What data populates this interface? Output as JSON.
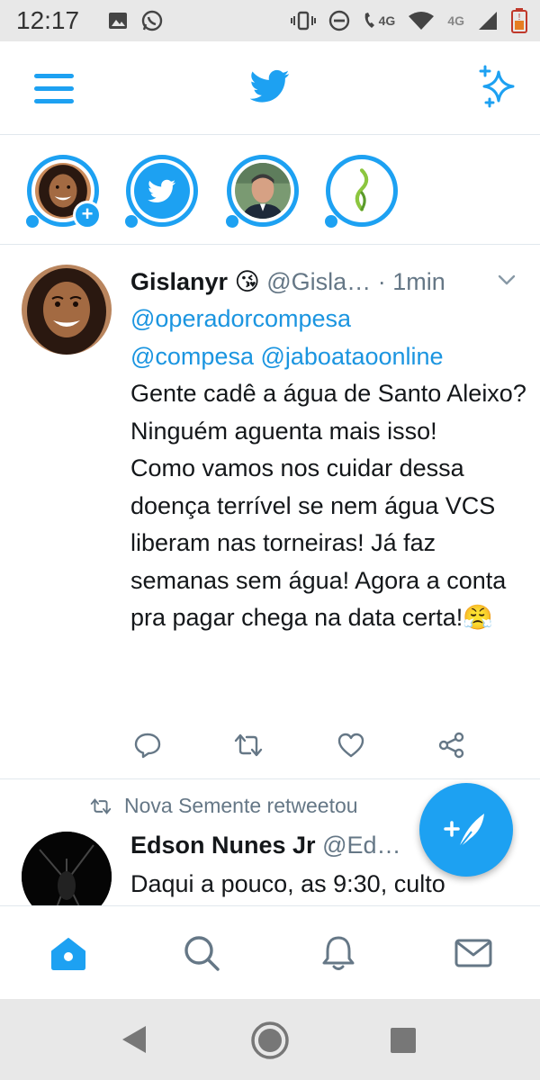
{
  "status_bar": {
    "time": "12:17",
    "network_label_1": "4G",
    "network_label_2": "4G"
  },
  "app_bar": {
    "menu_icon": "hamburger-menu-icon",
    "logo_icon": "twitter-bird-icon",
    "sparkle_icon": "sparkle-icon"
  },
  "fleets": [
    {
      "name": "own-fleet",
      "has_add": true
    },
    {
      "name": "twitter-fleet"
    },
    {
      "name": "user-fleet"
    },
    {
      "name": "plant-fleet"
    }
  ],
  "tweet1": {
    "name": "Gislanyr",
    "emoji": "😘",
    "handle": "@Gisla…",
    "dot": " · ",
    "time": "1min",
    "mentions_line1": "@operadorcompesa",
    "mention_2": "@compesa",
    "mention_3": "@jaboataoonline",
    "text": "Gente cadê a água de Santo Aleixo? Ninguém aguenta mais isso!\nComo vamos nos cuidar dessa doença terrível se nem água VCS liberam nas torneiras! Já faz semanas sem água! Agora a conta pra pagar chega na data certa!",
    "end_emoji": "😤"
  },
  "tweet2": {
    "retweet_label": "Nova Semente retweetou",
    "name": "Edson Nunes Jr",
    "handle": "@Ed…",
    "text": "Daqui a pouco, as 9:30, culto"
  },
  "colors": {
    "accent": "#1da1f2",
    "text": "#14171a",
    "muted": "#657786",
    "link": "#1b95e0",
    "divider": "#e1e8ed"
  }
}
